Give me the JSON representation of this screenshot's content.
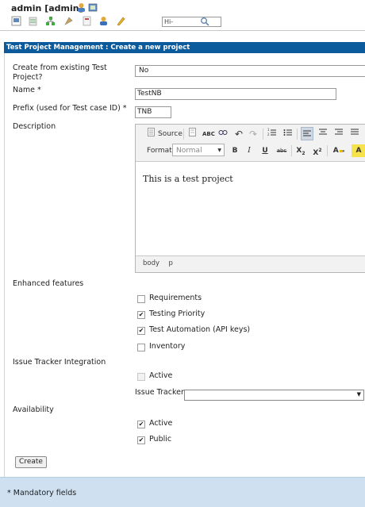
{
  "header": {
    "user": "admin [admin]",
    "search": {
      "placeholder": "Hi-"
    }
  },
  "panel": {
    "title": "Test Project Management : Create a new project"
  },
  "form": {
    "create_from_label": "Create from existing Test Project?",
    "create_from_value": "No",
    "name_label": "Name *",
    "name_value": "TestNB",
    "prefix_label": "Prefix (used for Test case ID) *",
    "prefix_value": "TNB",
    "description_label": "Description",
    "editor": {
      "source_label": "Source",
      "format_label": "Format",
      "format_value": "Normal",
      "content": "This is a test project",
      "path_body": "body",
      "path_p": "p"
    },
    "enhanced_features_label": "Enhanced features",
    "features": [
      {
        "label": "Requirements",
        "checked": false
      },
      {
        "label": "Testing Priority",
        "checked": true
      },
      {
        "label": "Test Automation (API keys)",
        "checked": true
      },
      {
        "label": "Inventory",
        "checked": false
      }
    ],
    "issue_tracker_integration_label": "Issue Tracker Integration",
    "issue_active_label": "Active",
    "issue_tracker_label": "Issue Tracker",
    "availability_label": "Availability",
    "availability": [
      {
        "label": "Active",
        "checked": true
      },
      {
        "label": "Public",
        "checked": true
      }
    ],
    "create_button": "Create"
  },
  "footer": {
    "mandatory": "* Mandatory fields"
  },
  "colors": {
    "title_bar": "#0b5a9c",
    "footer": "#cfe0f0"
  }
}
